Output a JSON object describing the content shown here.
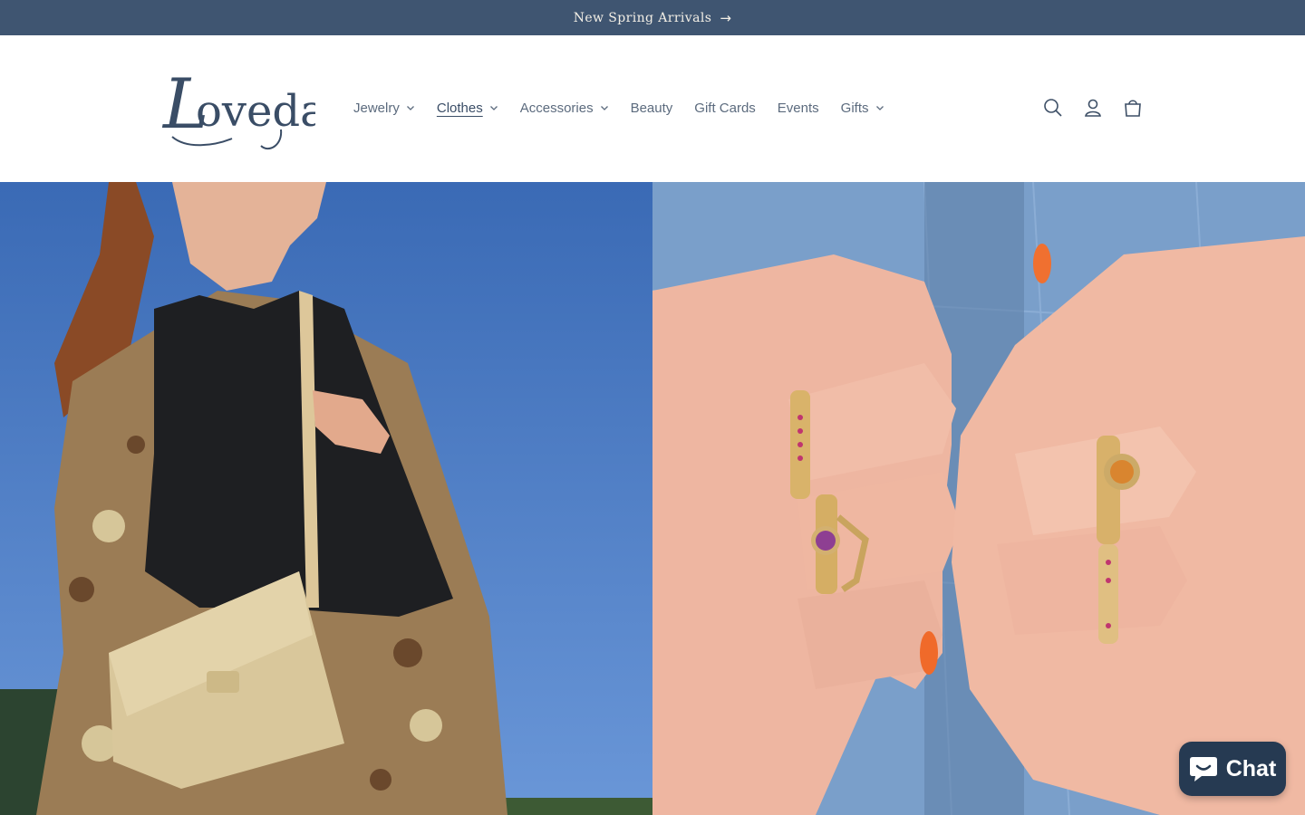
{
  "announcement": {
    "text": "New Spring Arrivals",
    "arrow_icon": "arrow-right-icon"
  },
  "header": {
    "logo_text": "Loveday",
    "nav": [
      {
        "label": "Jewelry",
        "has_dropdown": true,
        "active": false
      },
      {
        "label": "Clothes",
        "has_dropdown": true,
        "active": true
      },
      {
        "label": "Accessories",
        "has_dropdown": true,
        "active": false
      },
      {
        "label": "Beauty",
        "has_dropdown": false,
        "active": false
      },
      {
        "label": "Gift Cards",
        "has_dropdown": false,
        "active": false
      },
      {
        "label": "Events",
        "has_dropdown": false,
        "active": false
      },
      {
        "label": "Gifts",
        "has_dropdown": true,
        "active": false
      }
    ],
    "icons": [
      "search-icon",
      "account-icon",
      "cart-icon"
    ]
  },
  "hero": {
    "left_image": "woman-with-tan-crossbody-bag",
    "right_image": "hands-with-gemstone-rings"
  },
  "chat": {
    "label": "Chat",
    "icon": "chat-bubble-icon"
  },
  "colors": {
    "announcement_bg": "#3f5571",
    "announcement_text": "#f3efe6",
    "nav_text": "#5c6b7e",
    "logo": "#3a4d66",
    "chat_bg": "#263a52"
  }
}
